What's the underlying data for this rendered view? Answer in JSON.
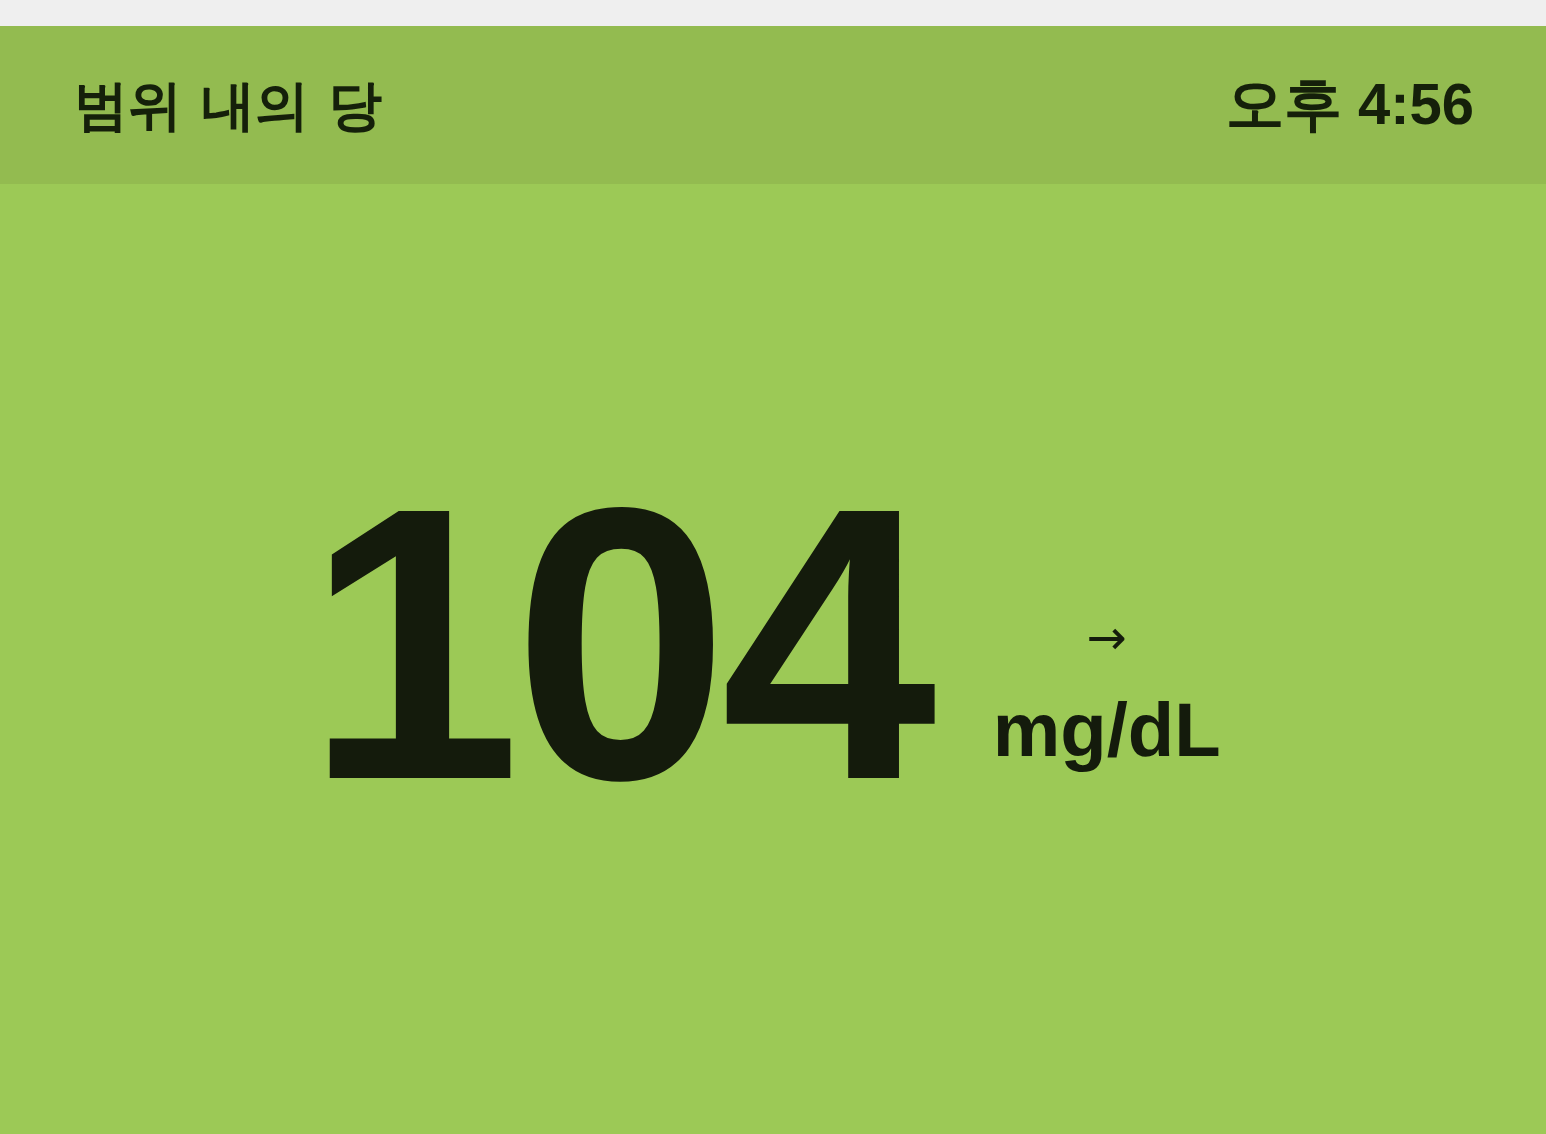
{
  "header": {
    "title": "범위 내의 당",
    "time": "오후 4:56"
  },
  "reading": {
    "value": "104",
    "unit": "mg/dL",
    "trend": "→"
  }
}
